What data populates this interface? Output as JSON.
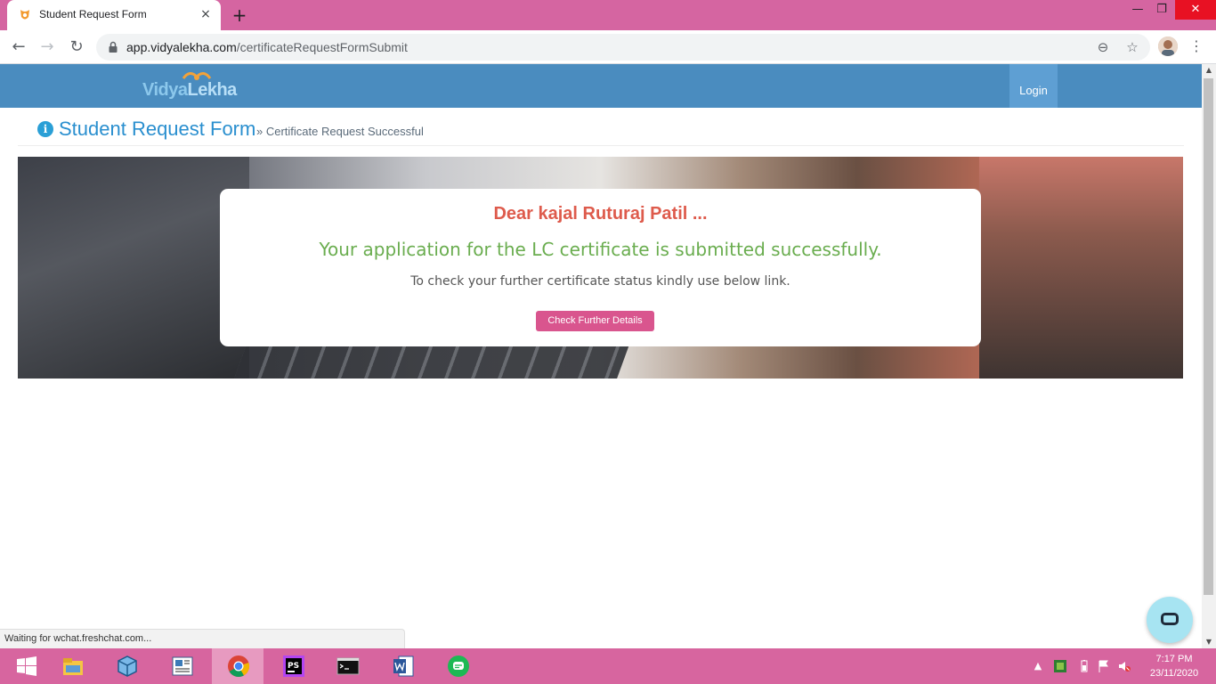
{
  "browser": {
    "tab_title": "Student Request Form",
    "tab_close_glyph": "×",
    "new_tab_glyph": "+",
    "url_host": "app.vidyalekha.com",
    "url_path": "/certificateRequestFormSubmit",
    "window_controls": {
      "minimize": "—",
      "maximize": "❐",
      "close": "✕"
    },
    "nav": {
      "back": "←",
      "forward": "→",
      "reload": "↻"
    },
    "omnibox_icons": {
      "zoom": "⊖",
      "bookmark": "☆"
    },
    "menu": "⋮"
  },
  "site": {
    "logo_part1": "Vidya",
    "logo_part2": "Lekha",
    "login_label": "Login"
  },
  "breadcrumb": {
    "title": "Student Request Form",
    "subtitle": "» Certificate Request Successful",
    "info_glyph": "i"
  },
  "message": {
    "greeting": "Dear kajal Ruturaj Patil ...",
    "success": "Your application for the LC certificate is submitted successfully.",
    "instruction": "To check your further certificate status kindly use below link.",
    "button_label": "Check Further Details"
  },
  "status_bar": {
    "text": "Waiting for wchat.freshchat.com..."
  },
  "taskbar": {
    "apps": [
      "start-icon",
      "file-explorer-icon",
      "3d-box-icon",
      "news-app-icon",
      "chrome-icon",
      "phpstorm-icon",
      "terminal-icon",
      "word-icon",
      "freshchat-icon"
    ],
    "time": "7:17 PM",
    "date": "23/11/2020",
    "ps_label": "PS"
  },
  "colors": {
    "tabstrip": "#d565a1",
    "site_header": "#4a8cbf",
    "greeting": "#de5b4c",
    "success": "#6aad4f",
    "button": "#d9558e"
  }
}
